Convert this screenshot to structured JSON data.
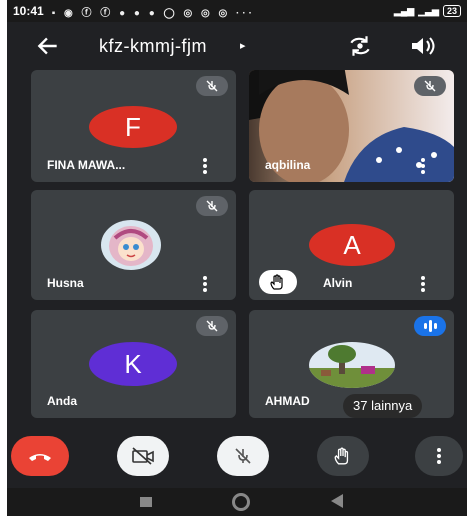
{
  "status_bar": {
    "time": "10:41",
    "notification_icons": "▪ ◉ ⓕ ⓕ ● ● ● ◯ ◎ ◎ ◎ ···",
    "battery": "23"
  },
  "meeting": {
    "title": "kfz-kmmj-fjm",
    "caret": "▸"
  },
  "tiles": [
    {
      "id": "fina",
      "initial": "F",
      "name": "FINA MAWA...",
      "avatar_color": "#d93025",
      "muted": true
    },
    {
      "id": "aqbilina",
      "name": "aqbilina",
      "muted": true,
      "video": true
    },
    {
      "id": "husna",
      "name": "Husna",
      "muted": true,
      "avatar": "cartoon-girl"
    },
    {
      "id": "alvin",
      "initial": "A",
      "name": "Alvin",
      "avatar_color": "#d93025",
      "hand_raised": true
    },
    {
      "id": "anda",
      "initial": "K",
      "name": "Anda",
      "avatar_color": "#5f2ed5",
      "muted": true
    },
    {
      "id": "ahmad",
      "name": "AHMAD",
      "speaking": true,
      "avatar": "landscape-photo"
    }
  ],
  "others_label": "37 lainnya",
  "colors": {
    "background": "#202124",
    "tile": "#3c4043",
    "end_call": "#ea4335",
    "accent_blue": "#1a73e8"
  }
}
